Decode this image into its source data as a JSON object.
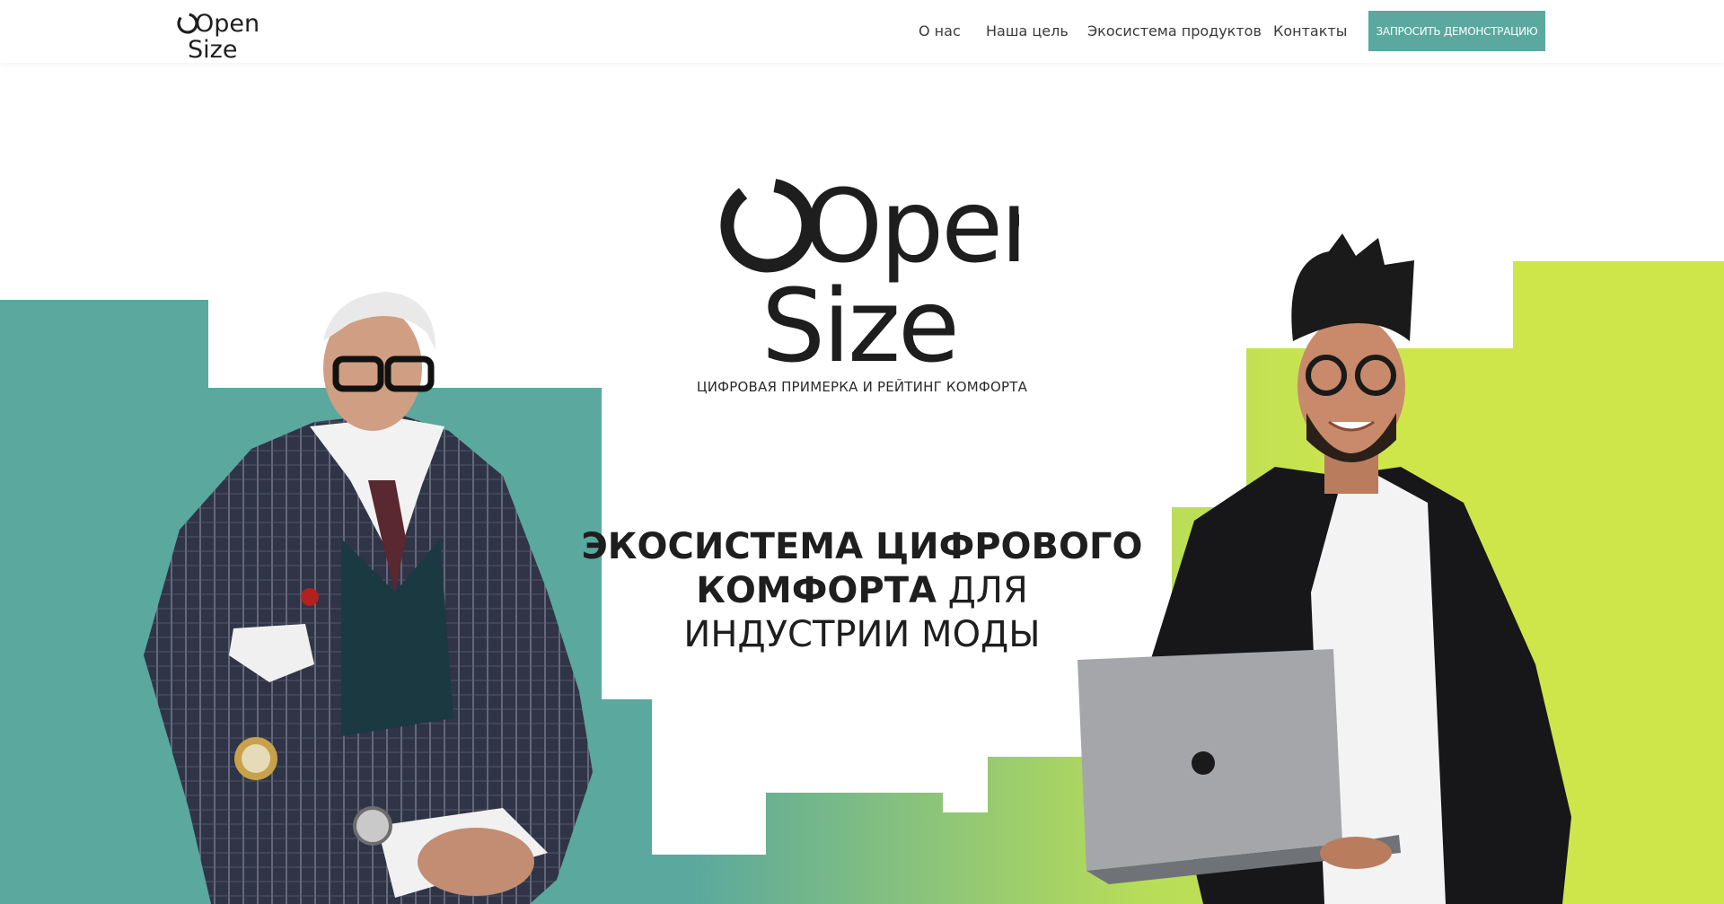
{
  "brand": {
    "logo_line1": "Open",
    "logo_line2": "Size",
    "tagline": "ЦИФРОВАЯ ПРИМЕРКА И РЕЙТИНГ КОМФОРТА"
  },
  "nav": {
    "items": [
      {
        "label": "О нас"
      },
      {
        "label": "Наша цель"
      },
      {
        "label": "Экосистема продуктов"
      },
      {
        "label": "Контакты"
      }
    ],
    "cta_label": "ЗАПРОСИТЬ ДЕМОНСТРАЦИЮ"
  },
  "hero": {
    "headline_bold_1": "ЭКОСИСТЕМА ЦИФРОВОГО",
    "headline_bold_2": "КОМФОРТА",
    "headline_regular_2": " ДЛЯ",
    "headline_regular_3": "ИНДУСТРИИ МОДЫ"
  },
  "colors": {
    "teal": "#5aa89e",
    "lime": "#cfe64a",
    "text": "#1e1e1e",
    "cta_bg": "#5aa89e"
  }
}
